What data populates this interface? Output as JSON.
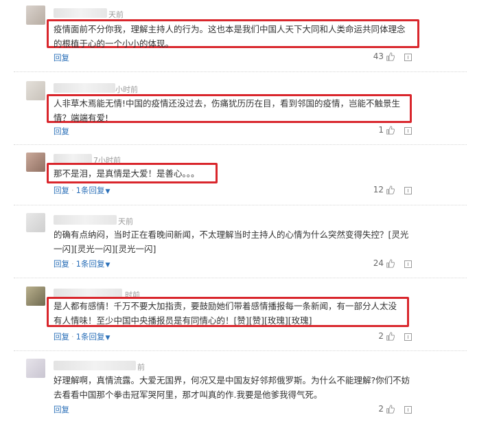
{
  "comments": [
    {
      "time": "天前",
      "text": "疫情面前不分你我，理解主持人的行为。这也本是我们中国人天下大同和人类命运共同体理念的根植于心的一个小小的体现。",
      "reply_label": "回复",
      "sub_replies_label": "",
      "likes": "43"
    },
    {
      "time": "小时前",
      "text": "人非草木焉能无情!中国的疫情还没过去，伤痛犹历历在目，看到邻国的疫情，岂能不触景生情？端端有爱!",
      "reply_label": "回复",
      "sub_replies_label": "",
      "likes": "1"
    },
    {
      "time": "7小时前",
      "text": "那不是泪，是真情是大爱！是善心。。。",
      "reply_label": "回复",
      "sub_replies_label": "1条回复",
      "likes": "12"
    },
    {
      "time": "天前",
      "text": "的确有点纳闷，当时正在看晚间新闻，不太理解当时主持人的心情为什么突然变得失控？[灵光一闪][灵光一闪][灵光一闪]",
      "reply_label": "回复",
      "sub_replies_label": "1条回复",
      "likes": "24"
    },
    {
      "time": "时前",
      "text": "是人都有感情！千万不要大加指责，要鼓励她们带着感情播报每一条新闻，有一部分人太没有人情味！至少中国中央播报员是有同情心的！[赞][赞][玫瑰][玫瑰]",
      "reply_label": "回复",
      "sub_replies_label": "1条回复",
      "likes": "2"
    },
    {
      "time": "前",
      "text": "好理解啊，真情流露。大爱无国界，何况又是中国友好邻邦俄罗斯。为什么不能理解?你们不妨去看看中国那个拳击冠军哭阿里，那才叫真的作.我要是他爹我得气死。",
      "reply_label": "回复",
      "sub_replies_label": "",
      "likes": "2"
    }
  ],
  "icons": {
    "thumb": "thumbs-up-icon",
    "report": "report-icon",
    "chevron": "chevron-down-icon"
  },
  "colors": {
    "highlight_border": "#d9262c",
    "link": "#2a6fb8",
    "meta": "#9a9a9a"
  }
}
